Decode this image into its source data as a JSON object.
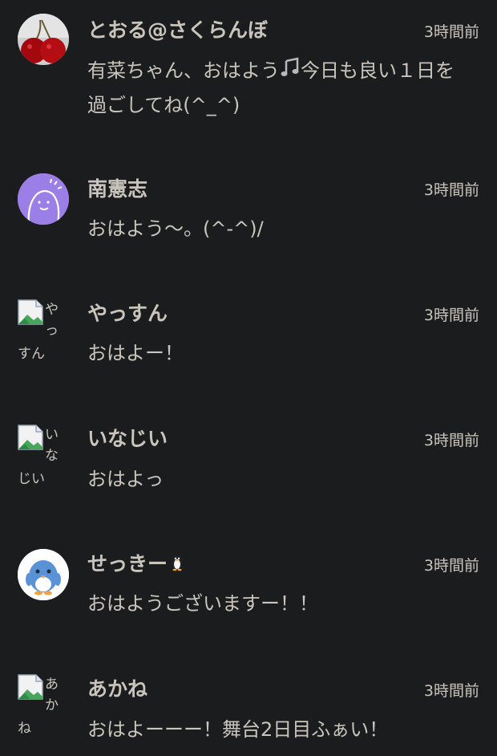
{
  "comments": [
    {
      "author": "とおる@さくらんぼ",
      "time": "3時間前",
      "text_before": "有菜ちゃん、おはよう",
      "emoji": "musical-notes-emoji",
      "text_after": "今日も良い１日を過ごしてね(^_^)",
      "avatar": "cherry-avatar"
    },
    {
      "author": "南憲志",
      "time": "3時間前",
      "text": "おはよう〜。(^-^)/",
      "avatar": "purple-face-avatar",
      "avatar_color": "#9b7fe6"
    },
    {
      "author": "やっすん",
      "time": "3時間前",
      "text": "おはよー！",
      "avatar": "broken-image-icon",
      "alt_top": "やっ",
      "alt_bottom": "すん"
    },
    {
      "author": "いなじい",
      "time": "3時間前",
      "text": "おはよっ",
      "avatar": "broken-image-icon",
      "alt_top": "いな",
      "alt_bottom": "じい"
    },
    {
      "author": "せっきー",
      "author_emoji": "penguin-emoji",
      "time": "3時間前",
      "text": "おはようございますー！！",
      "avatar": "penguin-avatar"
    },
    {
      "author": "あかね",
      "time": "3時間前",
      "text": "おはよーーー！舞台2日目ふぁい！",
      "avatar": "broken-image-icon",
      "alt_top": "あか",
      "alt_bottom": "ね"
    }
  ],
  "colors": {
    "background": "#1b1c1e",
    "text": "#c9c5bd",
    "purple_avatar": "#9b7fe6"
  }
}
